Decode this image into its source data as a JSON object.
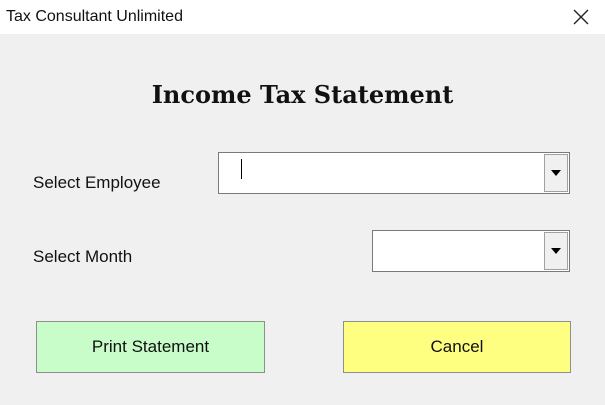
{
  "window": {
    "title": "Tax Consultant Unlimited"
  },
  "icons": {
    "close": "close-icon",
    "dropdown": "chevron-down-icon"
  },
  "form": {
    "heading": "Income Tax Statement",
    "employee": {
      "label": "Select Employee",
      "value": ""
    },
    "month": {
      "label": "Select Month",
      "value": ""
    }
  },
  "buttons": {
    "print_label": "Print Statement",
    "cancel_label": "Cancel"
  },
  "colors": {
    "print_button": "#c8fcc8",
    "cancel_button": "#fefe80",
    "dialog_background": "#f0f0f0"
  }
}
